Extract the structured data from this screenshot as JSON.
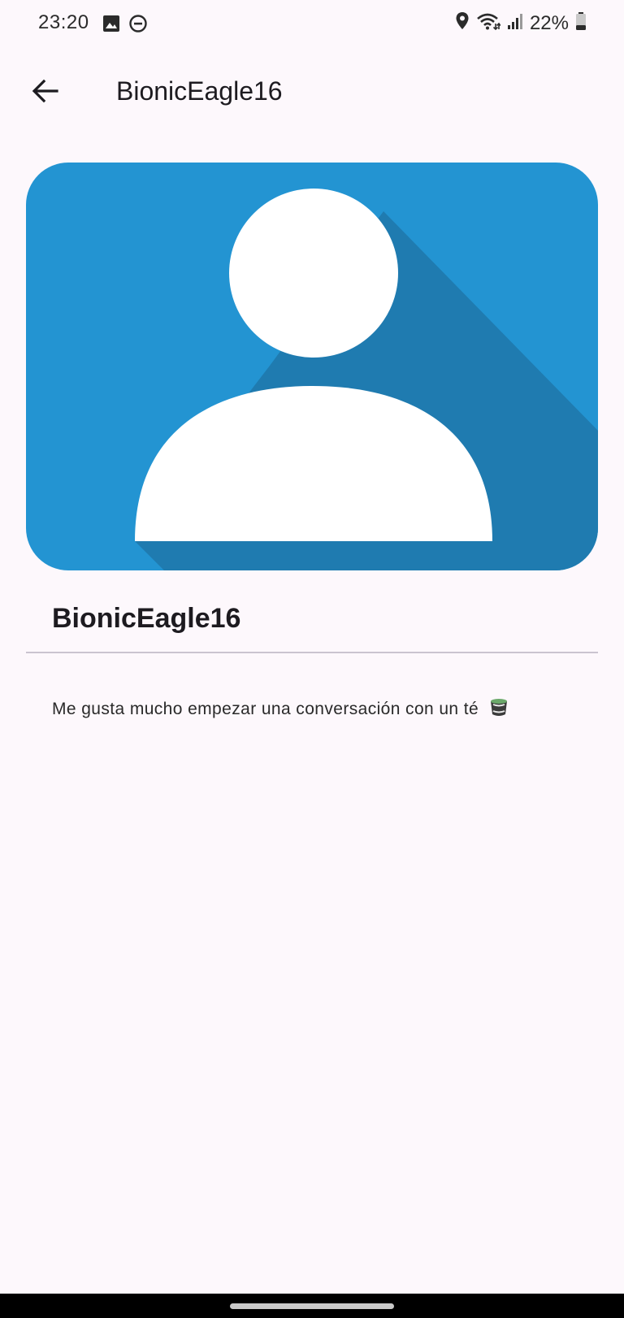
{
  "status_bar": {
    "time": "23:20",
    "battery": "22%",
    "icons_left": [
      "image-icon",
      "do-not-disturb-icon"
    ],
    "icons_right": [
      "location-icon",
      "wifi-icon",
      "signal-icon",
      "battery-icon"
    ]
  },
  "app_bar": {
    "back_icon": "arrow-back-icon",
    "title": "BionicEagle16"
  },
  "profile": {
    "avatar_icon": "person-icon",
    "avatar_background": "#2394d2",
    "name": "BionicEagle16",
    "bio": "Me gusta mucho empezar una conversación con un té",
    "bio_emoji": "teacup-icon"
  },
  "colors": {
    "background": "#fdf8fc",
    "divider": "#cac4d0",
    "avatar_shadow": "#1f7bb0"
  }
}
